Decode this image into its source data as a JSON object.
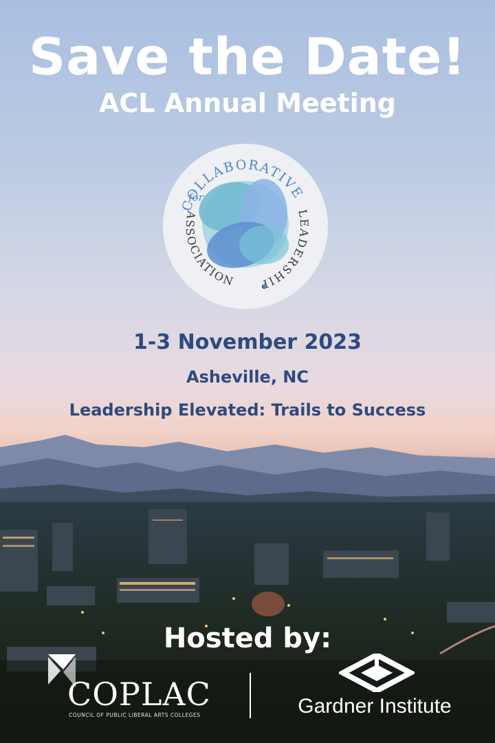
{
  "headline": "Save the Date!",
  "subheadline": "ACL Annual Meeting",
  "logo": {
    "text_top": "for COLLABORATIVE",
    "text_sides": "ASSOCIATION · LEADERSHIP",
    "icon": "overlapping-blue-petals-icon"
  },
  "event": {
    "dates": "1-3 November 2023",
    "location": "Asheville, NC",
    "theme": "Leadership Elevated: Trails to Success"
  },
  "hosts": {
    "label": "Hosted by:",
    "host1": {
      "name": "COPLAC",
      "subtitle": "COUNCIL OF PUBLIC LIBERAL ARTS COLLEGES"
    },
    "host2": {
      "name": "Gardner Institute"
    }
  },
  "colors": {
    "text_blue": "#2e4a7f",
    "sky_top": "#a9bfe0",
    "sunset": "#f1d3c9",
    "logo_teal": "#7cc3d6",
    "logo_blue": "#5b8fcf"
  }
}
